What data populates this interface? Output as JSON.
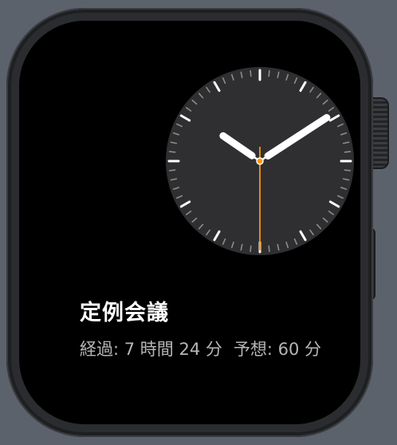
{
  "device": {
    "name": "Apple Watch",
    "case_color": "#2b2c2f",
    "background_color": "#5b626c"
  },
  "clock": {
    "time": "10:09",
    "hour": 10,
    "minute": 9,
    "second": 30,
    "dial_color": "#2f2f31",
    "hand_color": "#ffffff",
    "second_hand_color": "#ff9500"
  },
  "event": {
    "title": "定例会議",
    "elapsed_text": "経過: 7 時間 24 分",
    "expected_text": "予想: 60 分"
  }
}
